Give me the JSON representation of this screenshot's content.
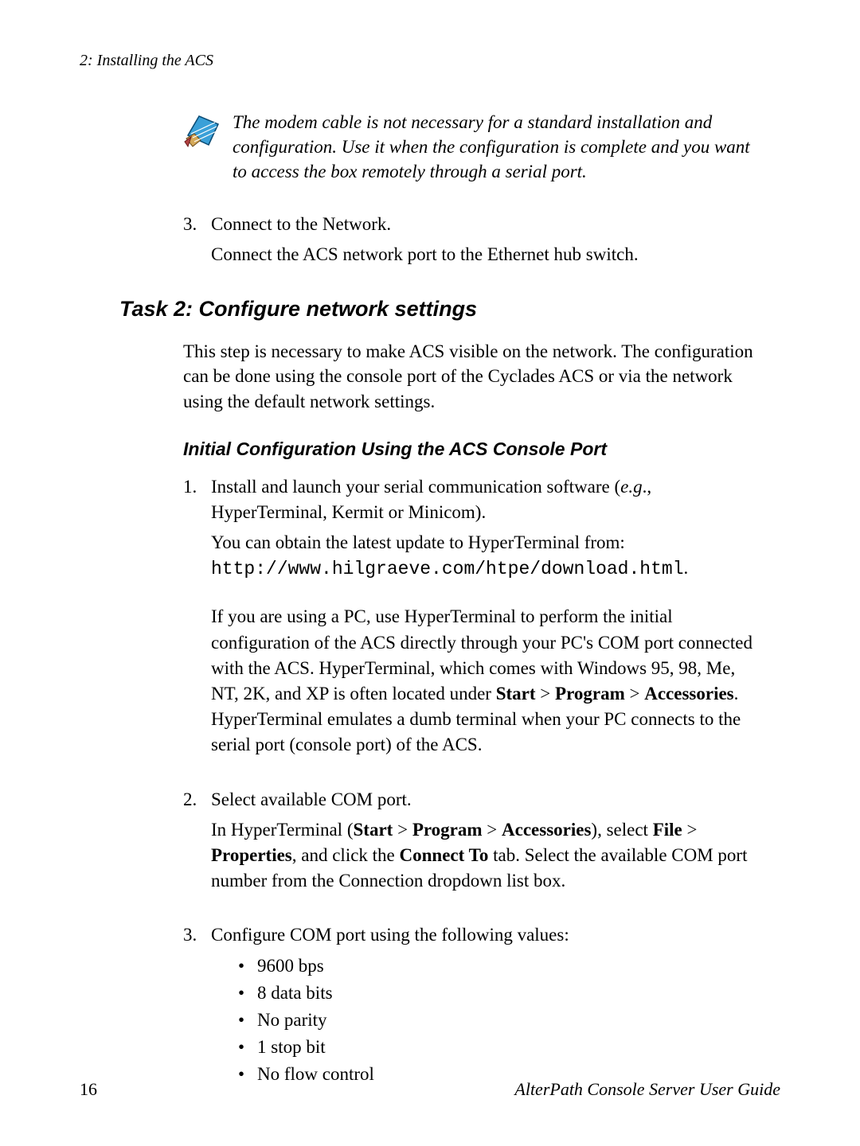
{
  "header": {
    "running": "2: Installing the ACS"
  },
  "note": {
    "text": "The modem cable is not necessary for a standard installation and configuration. Use it when the configuration is complete and you want to access the box remotely through a serial port."
  },
  "upper_list": {
    "item3": {
      "marker": "3.",
      "line1": "Connect to the Network.",
      "line2": "Connect the ACS network port to the Ethernet hub switch."
    }
  },
  "task2": {
    "heading": "Task 2: Configure network settings",
    "intro": "This step is necessary to make ACS visible on the network. The configuration can be done using the console port of the Cyclades ACS or via the network using the default network settings.",
    "subheading": "Initial Configuration Using the ACS Console Port",
    "steps": {
      "s1": {
        "marker": "1.",
        "p1a": "Install and launch your serial communication software (",
        "p1eg": "e.g",
        "p1b": "., HyperTerminal, Kermit or Minicom).",
        "p2a": "You can obtain the latest update to HyperTerminal from:",
        "p2url": "http://www.hilgraeve.com/htpe/download.html",
        "p2b": ".",
        "p3a": "If you are using a PC, use HyperTerminal to perform the initial configuration of the ACS directly through your PC's COM port connected with the ACS. HyperTerminal, which comes with Windows 95, 98, Me, NT, 2K, and XP is often located under ",
        "p3_start": "Start",
        "p3_gt1": " > ",
        "p3_program": "Program",
        "p3_gt2": " > ",
        "p3_acc": "Accessories",
        "p3b": ". HyperTerminal emulates a dumb terminal when your PC connects to the serial port (console port) of the ACS."
      },
      "s2": {
        "marker": "2.",
        "p1": "Select available COM port.",
        "p2a": "In HyperTerminal (",
        "p2_start": "Start",
        "p2_gt1": " > ",
        "p2_program": "Program",
        "p2_gt2": " > ",
        "p2_acc": "Accessories",
        "p2b": "), select ",
        "p2_file": "File",
        "p2_gt3": " > ",
        "p2_props": "Properties",
        "p2c": ", and click the ",
        "p2_connect": "Connect To",
        "p2d": " tab. Select the available COM port number from the Connection dropdown list box."
      },
      "s3": {
        "marker": "3.",
        "p1": "Configure COM port using the following values:",
        "bullets": {
          "b1": "9600 bps",
          "b2": "8 data bits",
          "b3": "No parity",
          "b4": "1 stop bit",
          "b5": "No flow control"
        }
      }
    }
  },
  "footer": {
    "page": "16",
    "title": "AlterPath Console Server User Guide"
  }
}
